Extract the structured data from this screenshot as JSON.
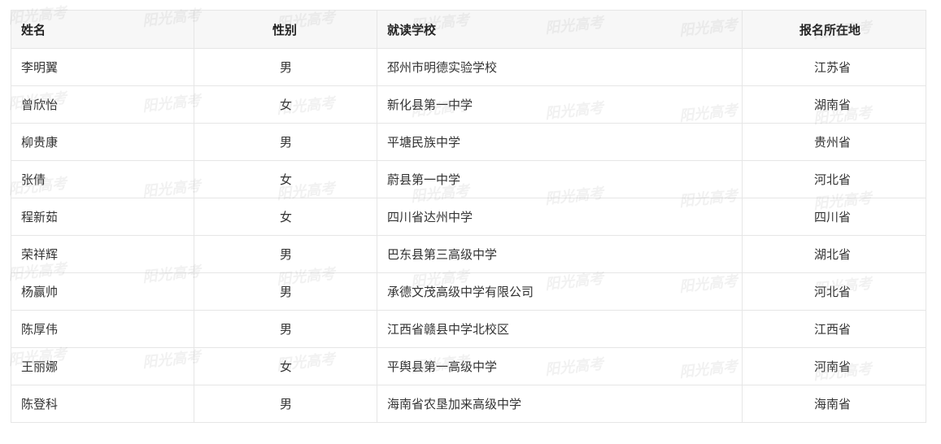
{
  "table": {
    "headers": {
      "name": "姓名",
      "gender": "性别",
      "school": "就读学校",
      "province": "报名所在地"
    },
    "rows": [
      {
        "name": "李明翼",
        "gender": "男",
        "school": "邳州市明德实验学校",
        "province": "江苏省"
      },
      {
        "name": "曾欣怡",
        "gender": "女",
        "school": "新化县第一中学",
        "province": "湖南省"
      },
      {
        "name": "柳贵康",
        "gender": "男",
        "school": "平塘民族中学",
        "province": "贵州省"
      },
      {
        "name": "张倩",
        "gender": "女",
        "school": "蔚县第一中学",
        "province": "河北省"
      },
      {
        "name": "程新茹",
        "gender": "女",
        "school": "四川省达州中学",
        "province": "四川省"
      },
      {
        "name": "荣祥辉",
        "gender": "男",
        "school": "巴东县第三高级中学",
        "province": "湖北省"
      },
      {
        "name": "杨赢帅",
        "gender": "男",
        "school": "承德文茂高级中学有限公司",
        "province": "河北省"
      },
      {
        "name": "陈厚伟",
        "gender": "男",
        "school": "江西省赣县中学北校区",
        "province": "江西省"
      },
      {
        "name": "王丽娜",
        "gender": "女",
        "school": "平舆县第一高级中学",
        "province": "河南省"
      },
      {
        "name": "陈登科",
        "gender": "男",
        "school": "海南省农垦加来高级中学",
        "province": "海南省"
      }
    ]
  },
  "watermark": {
    "text": "阳光高考"
  }
}
